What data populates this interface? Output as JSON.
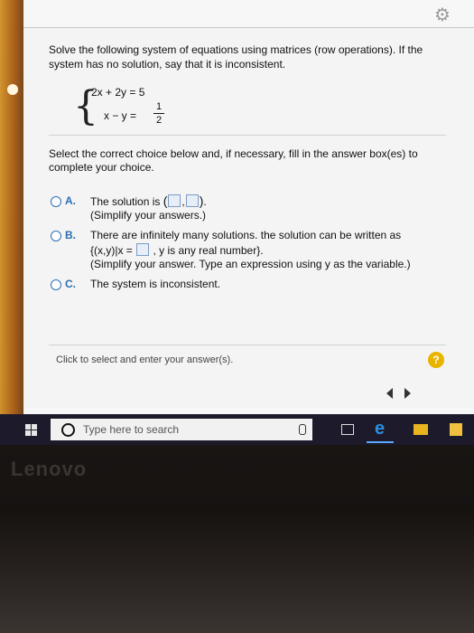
{
  "question": {
    "prompt": "Solve the following system of equations using matrices (row operations). If the system has no solution, say that it is inconsistent.",
    "equation1": "2x + 2y = 5",
    "equation2_lhs": "x − y =",
    "equation2_num": "1",
    "equation2_den": "2",
    "instructions": "Select the correct choice below and, if necessary, fill in the answer box(es) to complete your choice."
  },
  "choices": {
    "a": {
      "letter": "A.",
      "text_prefix": "The solution is",
      "note": "(Simplify your answers.)"
    },
    "b": {
      "letter": "B.",
      "text": "There are infinitely many solutions. the solution can be written as",
      "set_prefix": "{(x,y)|x =",
      "set_suffix": ", y is any real number}.",
      "note": "(Simplify your answer. Type an expression using y as the variable.)"
    },
    "c": {
      "letter": "C.",
      "text": "The system is inconsistent."
    }
  },
  "footer": {
    "status": "Click to select and enter your answer(s).",
    "help_label": "?"
  },
  "taskbar": {
    "search_placeholder": "Type here to search"
  },
  "brand": {
    "name": "Lenovo"
  },
  "icons": {
    "settings": "gear-icon",
    "help": "question-icon",
    "prev": "chevron-left-icon",
    "next": "chevron-right-icon",
    "windows": "windows-icon",
    "search": "search-icon",
    "mic": "microphone-icon",
    "task_view": "task-view-icon",
    "edge": "edge-icon",
    "files": "folder-icon",
    "store": "store-icon"
  },
  "colors": {
    "accent": "#2a6fb5",
    "help": "#e8b400",
    "taskbar": "#1d1b2b"
  }
}
